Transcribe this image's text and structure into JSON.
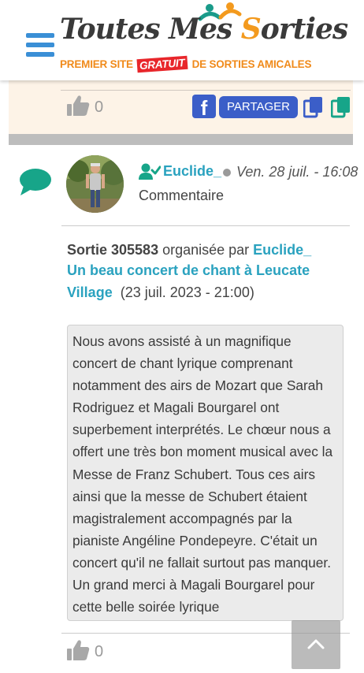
{
  "header": {
    "logo_title_part1": "Toutes Mes ",
    "logo_title_o": "S",
    "logo_title_part2": "orties",
    "tagline_start": "PREMIER SITE ",
    "tagline_badge": "GRATUIT",
    "tagline_end": " DE SORTIES AMICALES",
    "menu_icon": "hamburger-icon"
  },
  "previous_card": {
    "like_count": "0",
    "facebook_label": "f",
    "share_label": "PARTAGER"
  },
  "comment": {
    "author": "Euclide_",
    "date": "Ven. 28 juil. - 16:08",
    "type": "Commentaire",
    "sortie_prefix": "Sortie 305583",
    "organized_by": " organisée par ",
    "organizer": "Euclide_",
    "event_title": "Un beau concert de chant à Leucate Village",
    "event_date": "(23 juil. 2023 - 21:00)",
    "text": "Nous avons assisté à un magnifique concert de chant lyrique comprenant notamment des airs de Mozart que Sarah Rodriguez et Magali Bourgarel ont superbement interprétés. Le chœur nous a offert une très bon moment musical avec la Messe de Franz Schubert. Tous ces airs ainsi que la messe de Schubert étaient magistralement accompagnés par la pianiste Angéline Pondepeyre. C'était un concert qu'il ne fallait surtout pas manquer. Un grand merci à Magali Bourgarel pour cette belle soirée lyrique",
    "like_count": "0"
  },
  "colors": {
    "accent": "#2aa2bf",
    "share_blue": "#3b5ec8",
    "copy_teal": "#17a589",
    "menu_blue": "#3a8fd6",
    "logo_orange": "#f39a1e",
    "badge_red": "#e8262b"
  },
  "icons": [
    "hamburger-icon",
    "thumbs-up-icon",
    "facebook-icon",
    "copy-icon",
    "chat-bubble-icon",
    "user-check-icon",
    "chevron-up-icon"
  ]
}
